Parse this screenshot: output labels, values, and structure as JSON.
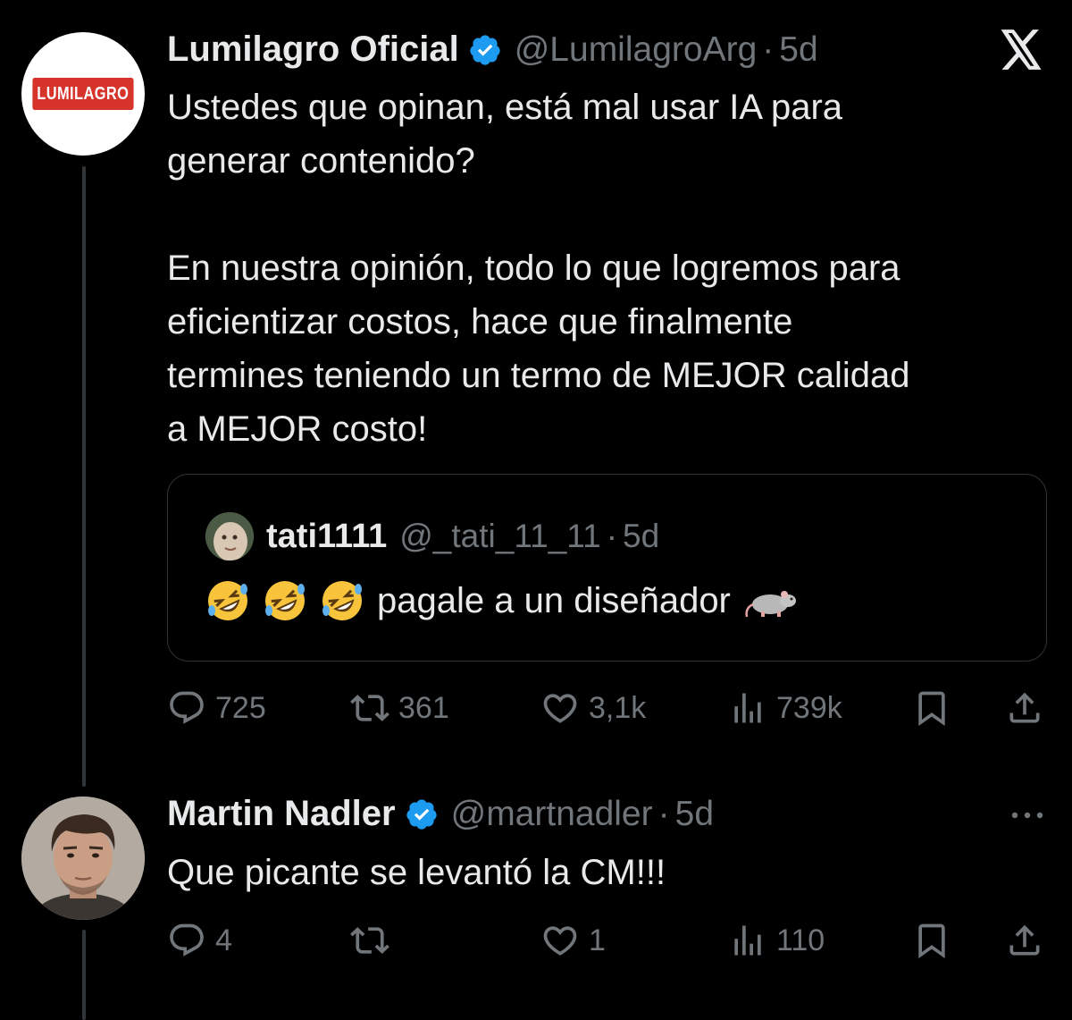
{
  "tweet1": {
    "author_name": "Lumilagro Oficial",
    "handle": "@LumilagroArg",
    "separator": "·",
    "time": "5d",
    "avatar_text": "LUMILAGRO",
    "text": "Ustedes que opinan, está mal usar IA para\ngenerar contenido?\n\nEn nuestra opinión, todo lo que logremos para\neficientizar costos, hace que finalmente\ntermines teniendo un termo de MEJOR calidad\na MEJOR costo!",
    "quote": {
      "author_name": "tati1111",
      "handle": "@_tati_11_11",
      "separator": "·",
      "time": "5d",
      "text": "pagale a un diseñador"
    },
    "actions": {
      "replies": "725",
      "reposts": "361",
      "likes": "3,1k",
      "views": "739k"
    }
  },
  "tweet2": {
    "author_name": "Martin Nadler",
    "handle": "@martnadler",
    "separator": "·",
    "time": "5d",
    "text": "Que picante se levantó la CM!!!",
    "actions": {
      "replies": "4",
      "reposts": "",
      "likes": "1",
      "views": "110"
    }
  },
  "colors": {
    "background": "#000000",
    "text": "#e7e9ea",
    "muted": "#71767b",
    "verified": "#1d9bf0",
    "brand_red": "#d6332b"
  },
  "icons": [
    "x-logo-icon",
    "verified-icon",
    "reply-icon",
    "repost-icon",
    "like-icon",
    "views-icon",
    "bookmark-icon",
    "share-icon",
    "more-icon",
    "rofl-emoji-icon",
    "rat-emoji-icon"
  ]
}
